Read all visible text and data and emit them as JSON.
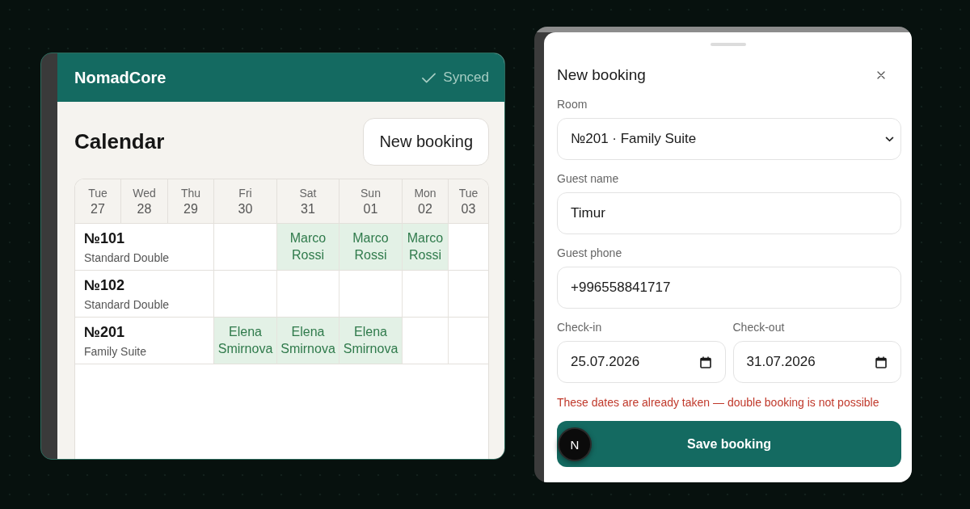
{
  "calendar_app": {
    "brand": "NomadCore",
    "sync_status": {
      "label": "Synced",
      "synced": true
    },
    "title": "Calendar",
    "new_booking_button": "New booking",
    "days": [
      {
        "weekday": "Tue",
        "day": "27"
      },
      {
        "weekday": "Wed",
        "day": "28"
      },
      {
        "weekday": "Thu",
        "day": "29"
      },
      {
        "weekday": "Fri",
        "day": "30"
      },
      {
        "weekday": "Sat",
        "day": "31"
      },
      {
        "weekday": "Sun",
        "day": "01"
      },
      {
        "weekday": "Mon",
        "day": "02"
      },
      {
        "weekday": "Tue",
        "day": "03"
      }
    ],
    "rooms": [
      {
        "number": "№101",
        "type": "Standard Double",
        "cells": [
          {
            "booked": false
          },
          {
            "booked": true,
            "guest": "Marco Rossi"
          },
          {
            "booked": true,
            "guest": "Marco Rossi"
          },
          {
            "booked": true,
            "guest": "Marco Rossi"
          },
          {
            "booked": false
          }
        ]
      },
      {
        "number": "№102",
        "type": "Standard Double",
        "cells": [
          {
            "booked": false
          },
          {
            "booked": false
          },
          {
            "booked": false
          },
          {
            "booked": false
          },
          {
            "booked": false
          }
        ]
      },
      {
        "number": "№201",
        "type": "Family Suite",
        "cells": [
          {
            "booked": true,
            "guest": "Elena Smirnova"
          },
          {
            "booked": true,
            "guest": "Elena Smirnova"
          },
          {
            "booked": true,
            "guest": "Elena Smirnova"
          },
          {
            "booked": false
          },
          {
            "booked": false
          }
        ]
      }
    ]
  },
  "booking_sheet": {
    "title": "New booking",
    "fields": [
      {
        "kind": "select",
        "label": "Room",
        "value": "№201 · Family Suite"
      },
      {
        "kind": "text",
        "label": "Guest name",
        "value": "Timur"
      },
      {
        "kind": "text",
        "label": "Guest phone",
        "value": "+996558841717"
      },
      {
        "kind": "date",
        "label": "Check-in",
        "value": "25.07.2026"
      },
      {
        "kind": "date",
        "label": "Check-out",
        "value": "31.07.2026"
      }
    ],
    "error": "These dates are already taken — double booking is not possible",
    "save_button": "Save booking"
  },
  "dev_badge": {
    "label": "N"
  }
}
